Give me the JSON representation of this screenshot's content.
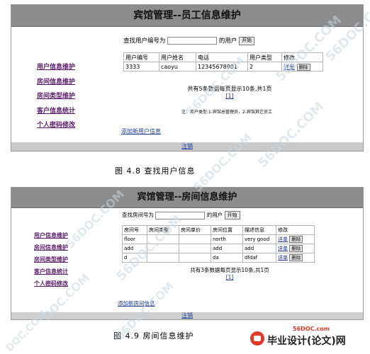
{
  "figure1": {
    "title": "宾馆管理--员工信息维护",
    "sidebar": [
      "用户信息维护",
      "房间信息维护",
      "房间类型维护",
      "客户信息统计",
      "个人密码修改"
    ],
    "search": {
      "prefix": "查找用户编号为",
      "suffix": "的用户",
      "button": "开始",
      "value": ""
    },
    "table": {
      "headers": [
        "用户编号",
        "用户姓名",
        "电话",
        "用户类型",
        "修改"
      ],
      "rows": [
        {
          "id": "3333",
          "name": "caoyu",
          "phone": "12345678901",
          "type": "2",
          "edit": "详单",
          "delete": "删除"
        }
      ]
    },
    "pager": "共有5条数据每页显示10条,共1页",
    "page_link": "[1]",
    "note": "注：用户类型:1-宾馆总管理员，2-宾馆其它员工",
    "add_link": "添加新用户信息",
    "logout": "注销",
    "caption": "图 4.8  查找用户信息"
  },
  "figure2": {
    "title": "宾馆管理--房间信息维护",
    "sidebar": [
      "用户信息维护",
      "房间信息维护",
      "房间类型维护",
      "客户信息统计",
      "个人密码修改"
    ],
    "search": {
      "prefix": "查找房间号为",
      "suffix": "的用户",
      "button": "开始",
      "value": ""
    },
    "table": {
      "headers": [
        "房间号",
        "房间类型",
        "房间单价",
        "房间位置",
        "描述信息",
        "修改"
      ],
      "rows": [
        {
          "c1": "floor",
          "c2": "",
          "c3": "",
          "c4": "north",
          "c5": "very good",
          "edit": "详单",
          "delete": "删除"
        },
        {
          "c1": "add",
          "c2": "",
          "c3": "",
          "c4": "add",
          "c5": "add",
          "edit": "详单",
          "delete": "删除"
        },
        {
          "c1": "d",
          "c2": "",
          "c3": "",
          "c4": "da",
          "c5": "dfdaf",
          "edit": "详单",
          "delete": "删除"
        }
      ]
    },
    "pager": "共有3条数据每页显示10条,共1页",
    "page_link": "[1]",
    "add_link": "添加新房间信息",
    "logout": "注销",
    "caption": "图 4.9  房间信息维护"
  },
  "watermarks": [
    "56DOC.COM",
    "56DOC.COM",
    "56DOC.COM",
    "56DOC.COM",
    "56DOC.COM",
    "56DOC.COM",
    "56DOC.COM",
    "DOC.COM",
    "56DOC.COM",
    "DOC.COM"
  ],
  "logo": {
    "url": "56DOC.com",
    "name": "毕业设计(论文)网"
  }
}
